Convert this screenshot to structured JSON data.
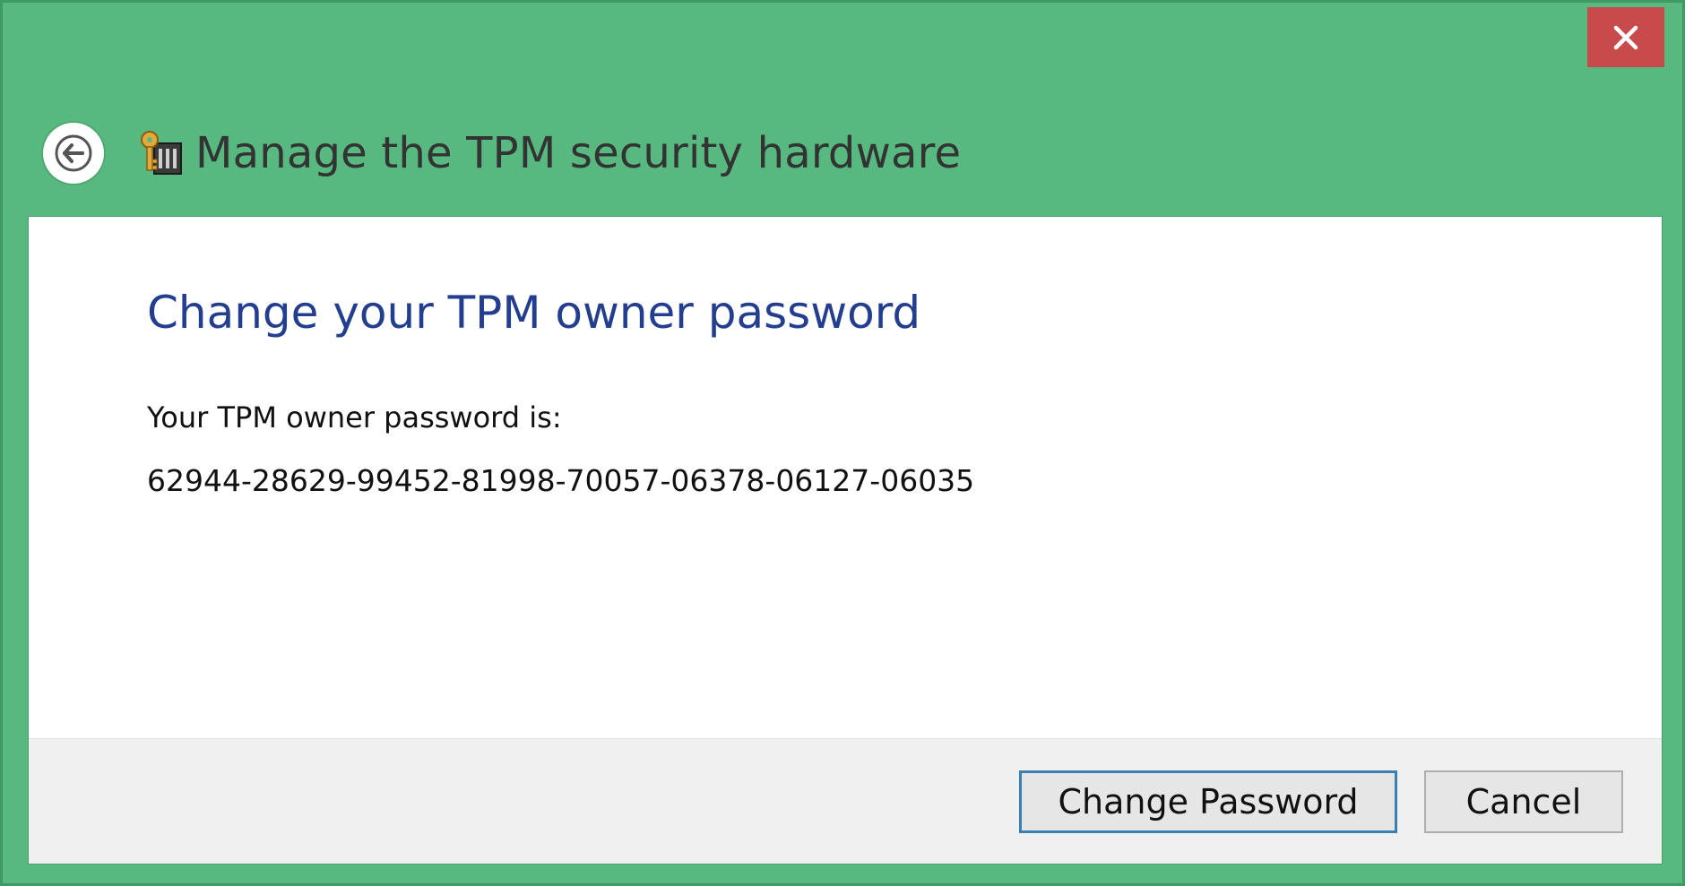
{
  "window": {
    "title": "Manage the TPM security hardware",
    "close_icon": "close-icon",
    "back_icon": "back-arrow-icon",
    "app_icon": "tpm-key-icon",
    "colors": {
      "titlebar": "#57b97f",
      "close_button": "#c94a4a",
      "heading": "#233d8f"
    }
  },
  "content": {
    "heading": "Change your TPM owner password",
    "password_label": "Your TPM owner password is:",
    "password_value": "62944-28629-99452-81998-70057-06378-06127-06035"
  },
  "footer": {
    "change_password_label": "Change Password",
    "cancel_label": "Cancel"
  }
}
